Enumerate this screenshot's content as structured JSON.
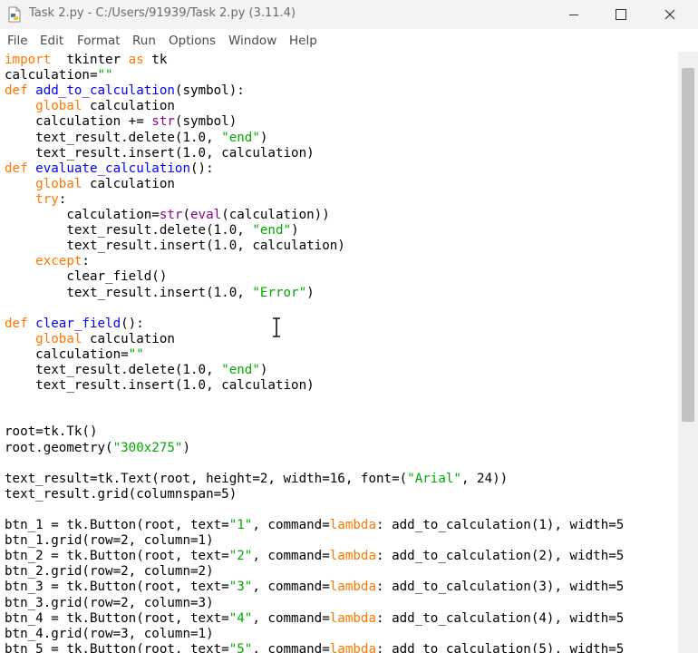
{
  "window": {
    "title": "Task 2.py - C:/Users/91939/Task 2.py (3.11.4)"
  },
  "menu": [
    "File",
    "Edit",
    "Format",
    "Run",
    "Options",
    "Window",
    "Help"
  ],
  "code": [
    [
      [
        "kw",
        "import"
      ],
      [
        "",
        "  tkinter "
      ],
      [
        "kw",
        "as"
      ],
      [
        "",
        " tk"
      ]
    ],
    [
      [
        "",
        "calculation="
      ],
      [
        "st",
        "\"\""
      ]
    ],
    [
      [
        "kw",
        "def"
      ],
      [
        "",
        " "
      ],
      [
        "df",
        "add_to_calculation"
      ],
      [
        "",
        "(symbol):"
      ]
    ],
    [
      [
        "",
        "    "
      ],
      [
        "kw",
        "global"
      ],
      [
        "",
        " calculation"
      ]
    ],
    [
      [
        "",
        "    calculation += "
      ],
      [
        "bi",
        "str"
      ],
      [
        "",
        "(symbol)"
      ]
    ],
    [
      [
        "",
        "    text_result.delete(1.0, "
      ],
      [
        "st",
        "\"end\""
      ],
      [
        "",
        ")"
      ]
    ],
    [
      [
        "",
        "    text_result.insert(1.0, calculation)"
      ]
    ],
    [
      [
        "kw",
        "def"
      ],
      [
        "",
        " "
      ],
      [
        "df",
        "evaluate_calculation"
      ],
      [
        "",
        "():"
      ]
    ],
    [
      [
        "",
        "    "
      ],
      [
        "kw",
        "global"
      ],
      [
        "",
        " calculation"
      ]
    ],
    [
      [
        "",
        "    "
      ],
      [
        "kw",
        "try"
      ],
      [
        "",
        ":"
      ]
    ],
    [
      [
        "",
        "        calculation="
      ],
      [
        "bi",
        "str"
      ],
      [
        "",
        "("
      ],
      [
        "bi",
        "eval"
      ],
      [
        "",
        "(calculation))"
      ]
    ],
    [
      [
        "",
        "        text_result.delete(1.0, "
      ],
      [
        "st",
        "\"end\""
      ],
      [
        "",
        ")"
      ]
    ],
    [
      [
        "",
        "        text_result.insert(1.0, calculation)"
      ]
    ],
    [
      [
        "",
        "    "
      ],
      [
        "kw",
        "except"
      ],
      [
        "",
        ":"
      ]
    ],
    [
      [
        "",
        "        clear_field()"
      ]
    ],
    [
      [
        "",
        "        text_result.insert(1.0, "
      ],
      [
        "st",
        "\"Error\""
      ],
      [
        "",
        ")"
      ]
    ],
    [],
    [
      [
        "kw",
        "def"
      ],
      [
        "",
        " "
      ],
      [
        "df",
        "clear_field"
      ],
      [
        "",
        "():"
      ]
    ],
    [
      [
        "",
        "    "
      ],
      [
        "kw",
        "global"
      ],
      [
        "",
        " calculation"
      ]
    ],
    [
      [
        "",
        "    calculation="
      ],
      [
        "st",
        "\"\""
      ]
    ],
    [
      [
        "",
        "    text_result.delete(1.0, "
      ],
      [
        "st",
        "\"end\""
      ],
      [
        "",
        ")"
      ]
    ],
    [
      [
        "",
        "    text_result.insert(1.0, calculation)"
      ]
    ],
    [],
    [],
    [
      [
        "",
        "root=tk.Tk()"
      ]
    ],
    [
      [
        "",
        "root.geometry("
      ],
      [
        "st",
        "\"300x275\""
      ],
      [
        "",
        ")"
      ]
    ],
    [],
    [
      [
        "",
        "text_result=tk.Text(root, height=2, width=16, font=("
      ],
      [
        "st",
        "\"Arial\""
      ],
      [
        "",
        ", 24))"
      ]
    ],
    [
      [
        "",
        "text_result.grid(columnspan=5)"
      ]
    ],
    [],
    [
      [
        "",
        "btn_1 = tk.Button(root, text="
      ],
      [
        "st",
        "\"1\""
      ],
      [
        "",
        ", command="
      ],
      [
        "kw",
        "lambda"
      ],
      [
        "",
        ": add_to_calculation(1), width=5"
      ]
    ],
    [
      [
        "",
        "btn_1.grid(row=2, column=1)"
      ]
    ],
    [
      [
        "",
        "btn_2 = tk.Button(root, text="
      ],
      [
        "st",
        "\"2\""
      ],
      [
        "",
        ", command="
      ],
      [
        "kw",
        "lambda"
      ],
      [
        "",
        ": add_to_calculation(2), width=5"
      ]
    ],
    [
      [
        "",
        "btn_2.grid(row=2, column=2)"
      ]
    ],
    [
      [
        "",
        "btn_3 = tk.Button(root, text="
      ],
      [
        "st",
        "\"3\""
      ],
      [
        "",
        ", command="
      ],
      [
        "kw",
        "lambda"
      ],
      [
        "",
        ": add_to_calculation(3), width=5"
      ]
    ],
    [
      [
        "",
        "btn_3.grid(row=2, column=3)"
      ]
    ],
    [
      [
        "",
        "btn_4 = tk.Button(root, text="
      ],
      [
        "st",
        "\"4\""
      ],
      [
        "",
        ", command="
      ],
      [
        "kw",
        "lambda"
      ],
      [
        "",
        ": add_to_calculation(4), width=5"
      ]
    ],
    [
      [
        "",
        "btn_4.grid(row=3, column=1)"
      ]
    ],
    [
      [
        "",
        "btn_5 = tk.Button(root, text="
      ],
      [
        "st",
        "\"5\""
      ],
      [
        "",
        ", command="
      ],
      [
        "kw",
        "lambda"
      ],
      [
        "",
        ": add_to_calculation(5), width=5"
      ]
    ]
  ]
}
